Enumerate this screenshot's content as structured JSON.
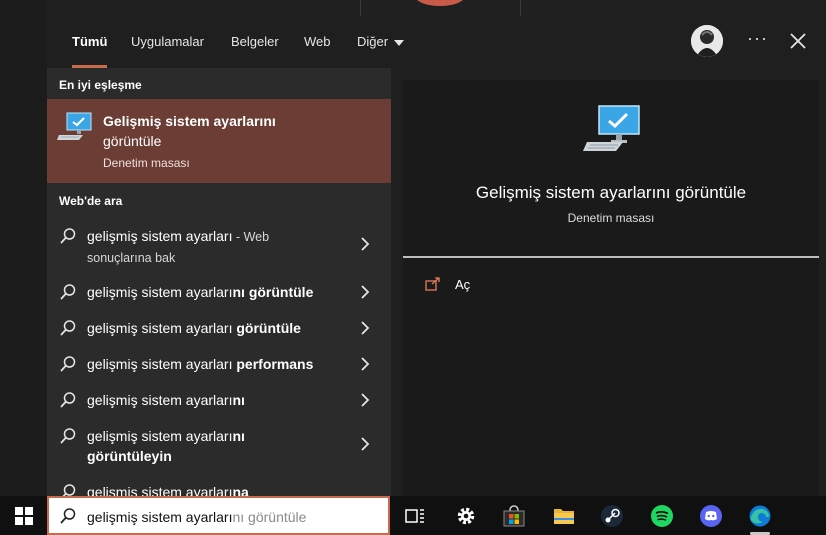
{
  "tabs": [
    {
      "label": "Tümü"
    },
    {
      "label": "Uygulamalar"
    },
    {
      "label": "Belgeler"
    },
    {
      "label": "Web"
    },
    {
      "label": "Diğer"
    }
  ],
  "sections": {
    "best_match": "En iyi eşleşme",
    "web_search": "Web'de ara"
  },
  "best_match": {
    "title_line1": "Gelişmiş sistem ayarlarını",
    "title_line2": "görüntüle",
    "subtitle": "Denetim masası"
  },
  "web_results": [
    {
      "plain": "gelişmiş sistem ayarları",
      "bold": "",
      "suffix": " - Web",
      "line2": "sonuçlarına bak"
    },
    {
      "plain": "gelişmiş sistem ayarları",
      "bold": "nı görüntüle",
      "suffix": "",
      "line2": ""
    },
    {
      "plain": "gelişmiş sistem ayarları ",
      "bold": "görüntüle",
      "suffix": "",
      "line2": ""
    },
    {
      "plain": "gelişmiş sistem ayarları ",
      "bold": "performans",
      "suffix": "",
      "line2": ""
    },
    {
      "plain": "gelişmiş sistem ayarları",
      "bold": "nı",
      "suffix": "",
      "line2": ""
    },
    {
      "plain": "gelişmiş sistem ayarları",
      "bold": "nı",
      "suffix": "",
      "line2": "görüntüleyin"
    },
    {
      "plain": "gelişmiş sistem ayarları",
      "bold": "na",
      "suffix": "",
      "line2": ""
    }
  ],
  "preview": {
    "title": "Gelişmiş sistem ayarlarını görüntüle",
    "subtitle": "Denetim masası",
    "open_label": "Aç"
  },
  "search": {
    "typed": "gelişmiş sistem ayarları",
    "completion": "nı görüntüle"
  },
  "colors": {
    "accent": "#c86a4c",
    "best_match_bg": "#6b3d35"
  }
}
